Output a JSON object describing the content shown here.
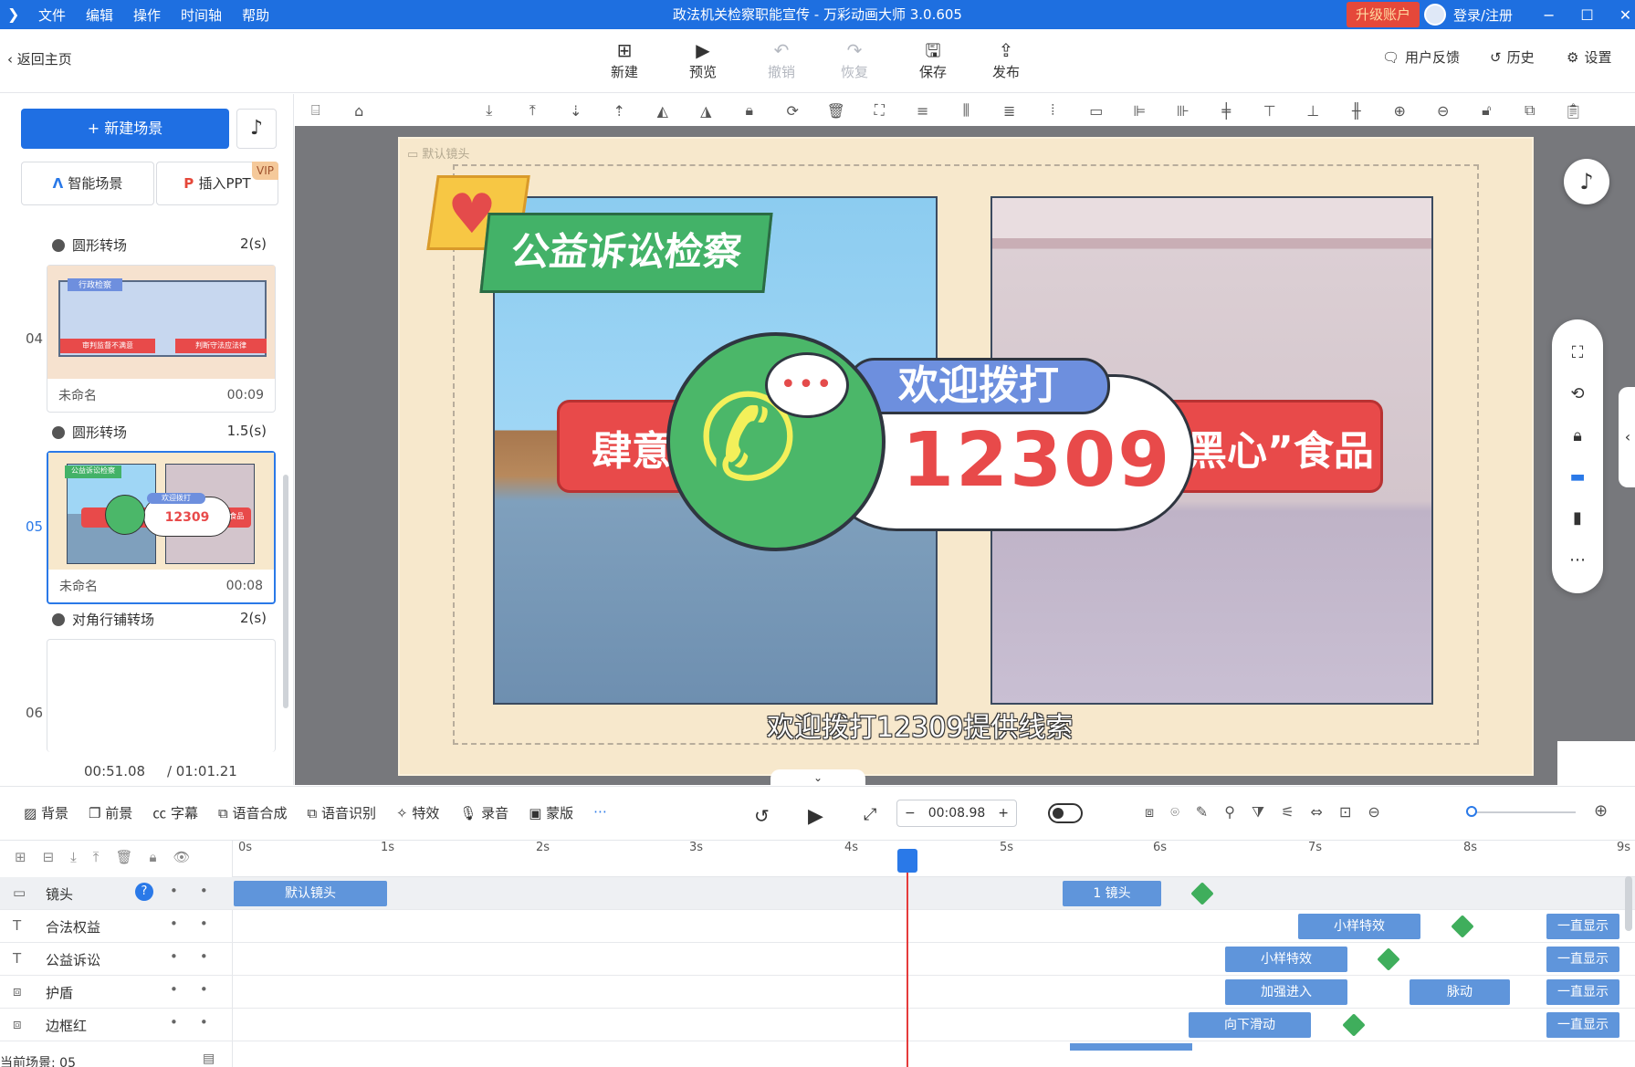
{
  "window": {
    "menu": [
      "文件",
      "编辑",
      "操作",
      "时间轴",
      "帮助"
    ],
    "title": "政法机关检察职能宣传 - 万彩动画大师 3.0.605",
    "upgrade": "升级账户",
    "login": "登录/注册",
    "controls": [
      "−",
      "☐",
      "✕"
    ]
  },
  "toolbar": {
    "back": "返回主页",
    "buttons": [
      {
        "label": "新建",
        "icon": "plus-square-icon"
      },
      {
        "label": "预览",
        "icon": "play-icon"
      },
      {
        "label": "撤销",
        "icon": "undo-icon"
      },
      {
        "label": "恢复",
        "icon": "redo-icon"
      },
      {
        "label": "保存",
        "icon": "save-icon"
      },
      {
        "label": "发布",
        "icon": "publish-icon"
      }
    ],
    "feedback": "用户反馈",
    "history": "历史",
    "settings": "设置"
  },
  "left": {
    "new_scene": "新建场景",
    "smart_scene": "智能场景",
    "insert_ppt": "插入PPT",
    "vip": "VIP",
    "items": [
      {
        "type": "transition",
        "name": "圆形转场",
        "dur": "2(s)"
      },
      {
        "type": "scene",
        "num": "04",
        "name": "未命名",
        "time": "00:09"
      },
      {
        "type": "transition",
        "name": "圆形转场",
        "dur": "1.5(s)"
      },
      {
        "type": "scene",
        "num": "05",
        "name": "未命名",
        "time": "00:08",
        "selected": true
      },
      {
        "type": "transition",
        "name": "对角行铺转场",
        "dur": "2(s)"
      },
      {
        "type": "scene",
        "num": "06"
      }
    ],
    "current_time": "00:51.08",
    "total_time": "/ 01:01.21"
  },
  "canvas": {
    "camera_label": "默认镜头",
    "green_banner": "公益诉讼检察",
    "blue_tag": "欢迎拨打",
    "red_left": "肆意",
    "red_right": "黑心”食品",
    "number": "12309",
    "subtitle": "欢迎拨打12309提供线索",
    "thumb_labels": [
      "行政检察",
      "审判监督不满意",
      "判断守法应法律",
      "公益诉讼检察",
      "欢迎拨打",
      "12309",
      "“黑心”食品"
    ]
  },
  "timeline": {
    "tools": [
      "背景",
      "前景",
      "字幕",
      "语音合成",
      "语音识别",
      "特效",
      "录音",
      "蒙版"
    ],
    "time": "00:08.98",
    "minus": "−",
    "plus": "+",
    "ticks": [
      "0s",
      "1s",
      "2s",
      "3s",
      "4s",
      "5s",
      "6s",
      "7s",
      "8s",
      "9s"
    ],
    "rows": [
      {
        "icon": "camera-icon",
        "name": "镜头",
        "clips": [
          {
            "label": "默认镜头"
          },
          {
            "label": "1 镜头"
          }
        ]
      },
      {
        "icon": "T",
        "name": "合法权益",
        "clips": [
          {
            "label": "小样特效"
          },
          {
            "label": "一直显示"
          }
        ]
      },
      {
        "icon": "T",
        "name": "公益诉讼",
        "clips": [
          {
            "label": "小样特效"
          },
          {
            "label": "一直显示"
          }
        ]
      },
      {
        "icon": "shape-icon",
        "name": "护盾",
        "clips": [
          {
            "label": "加强进入"
          },
          {
            "label": "脉动"
          },
          {
            "label": "一直显示"
          }
        ]
      },
      {
        "icon": "shape-icon",
        "name": "边框红",
        "clips": [
          {
            "label": "向下滑动"
          },
          {
            "label": "一直显示"
          }
        ]
      }
    ],
    "current_scene": "当前场景: 05"
  },
  "colors": {
    "accent": "#1f6fe3",
    "clip": "#5f95db",
    "playhead": "#e53b3b"
  }
}
